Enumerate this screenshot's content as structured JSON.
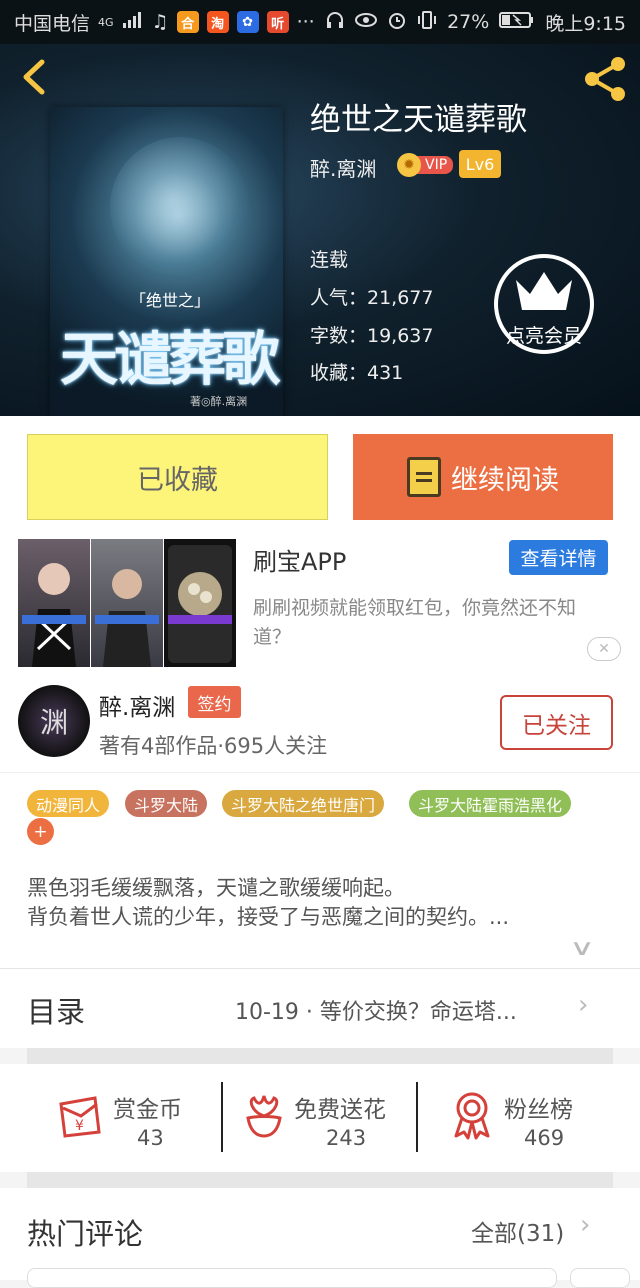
{
  "status_bar": {
    "carrier": "中国电信",
    "network": "4G",
    "battery": "27%",
    "time": "晚上9:15",
    "more": "···"
  },
  "book": {
    "title": "绝世之天谴葬歌",
    "author": "醉.离渊",
    "vip_label": "VIP",
    "level": "Lv6",
    "status": "连载",
    "popularity": "人气：21,677",
    "word_count": "字数：19,637",
    "favorites": "收藏：431",
    "member_label": "点亮会员",
    "cover_text": {
      "subtitle": "「绝世之」",
      "main": "天谴葬歌",
      "author": "著◎醉.离渊"
    }
  },
  "actions": {
    "collected_label": "已收藏",
    "continue_label": "继续阅读"
  },
  "ad": {
    "title": "刷宝APP",
    "detail_button": "查看详情",
    "description": "刷刷视频就能领取红包，你竟然还不知道？",
    "close": "✕"
  },
  "author_card": {
    "avatar_char": "渊",
    "name": "醉.离渊",
    "sign_badge": "签约",
    "info": "著有4部作品·695人关注",
    "follow_label": "已关注"
  },
  "tags": [
    {
      "label": "动漫同人",
      "color": "#f2b53c"
    },
    {
      "label": "斗罗大陆",
      "color": "#c8735f"
    },
    {
      "label": "斗罗大陆之绝世唐门",
      "color": "#d9a83e"
    },
    {
      "label": "斗罗大陆霍雨浩黑化",
      "color": "#8fbf56"
    }
  ],
  "tag_add": "+",
  "synopsis": {
    "line1": "黑色羽毛缓缓飘落，天谴之歌缓缓响起。",
    "line2": "背负着世人谎的少年，接受了与恶魔之间的契约。..."
  },
  "directory": {
    "label": "目录",
    "latest": "10-19 · 等价交换？命运塔..."
  },
  "stats": [
    {
      "label": "赏金币",
      "value": "43",
      "icon": "red-envelope-icon"
    },
    {
      "label": "免费送花",
      "value": "243",
      "icon": "flower-icon"
    },
    {
      "label": "粉丝榜",
      "value": "469",
      "icon": "medal-icon"
    }
  ],
  "comments": {
    "label": "热门评论",
    "all": "全部(31)"
  },
  "colors": {
    "accent_orange": "#ec6f43",
    "collected_yellow": "#fdf47a",
    "follow_red": "#c8443a",
    "ad_blue": "#2c7ce0"
  }
}
